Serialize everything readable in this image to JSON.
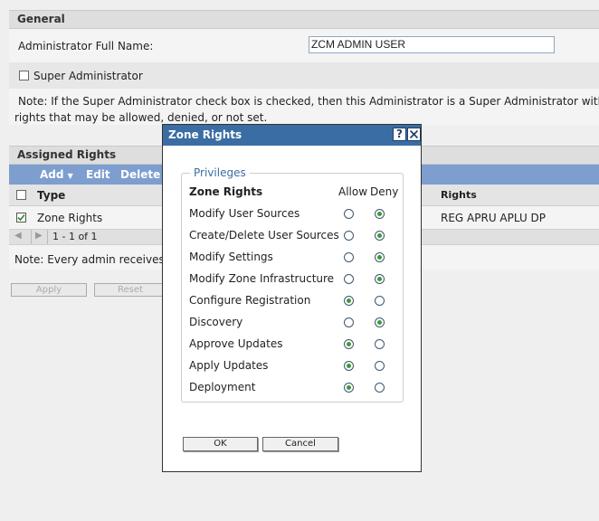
{
  "general": {
    "title": "General",
    "admin_name_label": "Administrator Full Name:",
    "admin_name_value": "ZCM ADMIN USER",
    "super_admin_label": "Super Administrator",
    "note_line1": "Note: If the Super Administrator check box is checked, then this Administrator is a Super Administrator with",
    "note_line2": "rights that may be allowed, denied, or not set."
  },
  "assigned": {
    "title": "Assigned Rights",
    "toolbar": {
      "add": "Add",
      "edit": "Edit",
      "delete": "Delete"
    },
    "columns": {
      "type": "Type",
      "rights": "Rights"
    },
    "row": {
      "type": "Zone Rights",
      "rights": "REG APRU APLU DP"
    },
    "pager": "1 - 1 of 1",
    "note": "Note: Every admin receives"
  },
  "buttons": {
    "apply": "Apply",
    "reset": "Reset"
  },
  "dialog": {
    "title": "Zone Rights",
    "help": "?",
    "legend": "Privileges",
    "header": {
      "label": "Zone Rights",
      "allow": "Allow",
      "deny": "Deny"
    },
    "rows": [
      {
        "label": "Modify User Sources",
        "value": "deny"
      },
      {
        "label": "Create/Delete User Sources",
        "value": "deny"
      },
      {
        "label": "Modify Settings",
        "value": "deny"
      },
      {
        "label": "Modify Zone Infrastructure",
        "value": "deny"
      },
      {
        "label": "Configure Registration",
        "value": "allow"
      },
      {
        "label": "Discovery",
        "value": "deny"
      },
      {
        "label": "Approve Updates",
        "value": "allow"
      },
      {
        "label": "Apply Updates",
        "value": "allow"
      },
      {
        "label": "Deployment",
        "value": "allow"
      }
    ],
    "ok": "OK",
    "cancel": "Cancel"
  }
}
